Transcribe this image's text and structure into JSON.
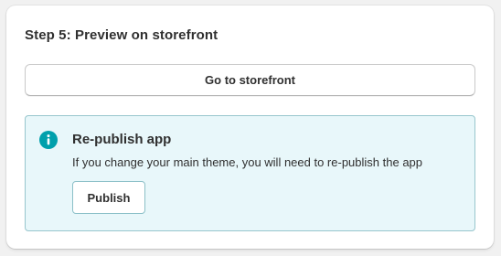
{
  "card": {
    "title": "Step 5: Preview on storefront",
    "storefront_button_label": "Go to storefront"
  },
  "banner": {
    "icon": "info-icon",
    "title": "Re-publish app",
    "message": "If you change your main theme, you will need to re-publish the app",
    "publish_button_label": "Publish"
  },
  "colors": {
    "banner_background": "#e8f7fa",
    "banner_border": "#98c6cd",
    "info_icon": "#00a0ac"
  }
}
